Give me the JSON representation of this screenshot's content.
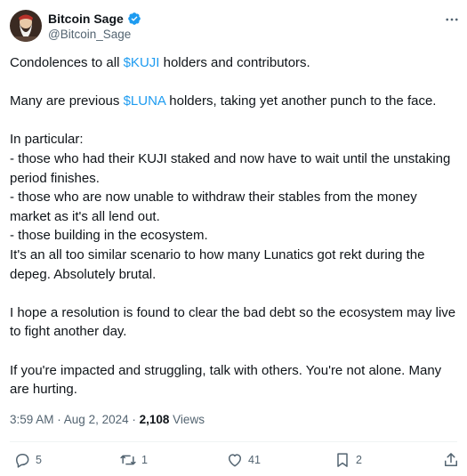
{
  "author": {
    "display_name": "Bitcoin Sage",
    "handle": "@Bitcoin_Sage",
    "avatar_icon": "avatar-photo"
  },
  "tweet": {
    "p1_a": "Condolences to all ",
    "p1_tag": "$KUJI",
    "p1_b": " holders and contributors.",
    "p2_a": "Many are previous ",
    "p2_tag": "$LUNA",
    "p2_b": " holders, taking yet another punch to the face.",
    "p3": "In particular:\n- those who had their KUJI staked and now have to wait until the unstaking period finishes.\n- those who are now unable to withdraw their stables from the money market as it's all lend out.\n- those building in the ecosystem.\nIt's an all too similar scenario to how many Lunatics got rekt during the depeg. Absolutely brutal.",
    "p4": "I hope a resolution is found to clear the bad debt so the ecosystem may live to fight another day.",
    "p5": "If you're impacted and struggling, talk with others. You're not alone. Many are hurting."
  },
  "meta": {
    "time": "3:59 AM",
    "sep": " · ",
    "date": "Aug 2, 2024",
    "views_count": "2,108",
    "views_label": " Views"
  },
  "actions": {
    "replies": "5",
    "reposts": "1",
    "likes": "41",
    "bookmarks": "2"
  },
  "colors": {
    "accent": "#1d9bf0",
    "text": "#0f1419",
    "muted": "#536471",
    "divider": "#eff3f4"
  }
}
